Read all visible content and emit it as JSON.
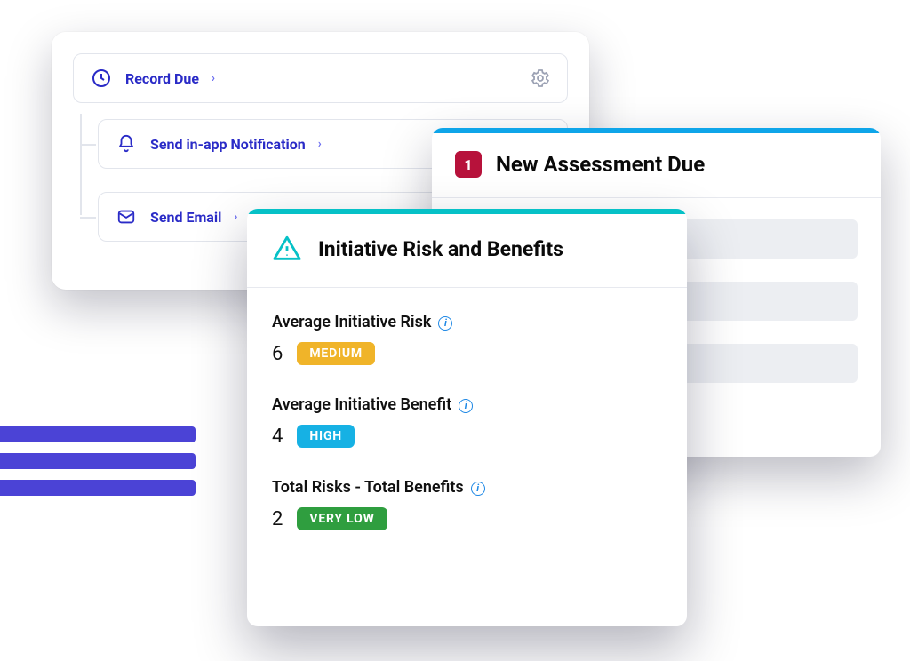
{
  "workflow": {
    "trigger": {
      "label": "Record Due"
    },
    "actions": [
      {
        "label": "Send in-app Notification"
      },
      {
        "label": "Send Email"
      }
    ]
  },
  "assessment": {
    "badge": "1",
    "title": "New Assessment Due"
  },
  "risk_panel": {
    "title": "Initiative Risk and Benefits",
    "metrics": [
      {
        "label": "Average Initiative Risk",
        "value": "6",
        "tag": "MEDIUM",
        "tag_class": "pill-medium"
      },
      {
        "label": "Average Initiative Benefit",
        "value": "4",
        "tag": "HIGH",
        "tag_class": "pill-high"
      },
      {
        "label": "Total Risks - Total Benefits",
        "value": "2",
        "tag": "VERY LOW",
        "tag_class": "pill-verylow"
      }
    ]
  }
}
